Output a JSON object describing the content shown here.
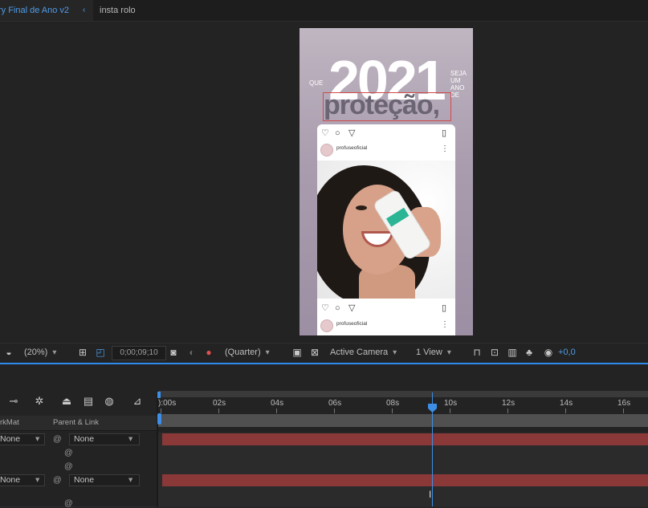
{
  "tabs": [
    {
      "label": "ry Final de Ano v2",
      "active": true
    },
    {
      "label": "insta rolo",
      "active": false
    }
  ],
  "composition": {
    "year": "2021",
    "que": "QUE",
    "seja": [
      "SEJA",
      "UM",
      "ANO",
      "DE"
    ],
    "protecao": "proteção,",
    "instagram_user_top": "profuseoficial",
    "instagram_user_bottom": "profuseoficial",
    "more_glyph": "⋮"
  },
  "viewer_toolbar": {
    "zoom": "(20%)",
    "timecode": "0;00;09;10",
    "resolution": "(Quarter)",
    "camera": "Active Camera",
    "views": "1 View",
    "exposure": "+0,0"
  },
  "timeline": {
    "ruler_labels": [
      "):00s",
      "02s",
      "04s",
      "06s",
      "08s",
      "10s",
      "12s",
      "14s",
      "16s"
    ],
    "columns": {
      "trkmat": "rkMat",
      "parent": "Parent & Link"
    },
    "layers": [
      {
        "trkmat": "None",
        "parent": "None",
        "has_bar": true
      },
      {
        "trkmat": "",
        "parent": "",
        "has_bar": false
      },
      {
        "trkmat": "",
        "parent": "",
        "has_bar": false
      },
      {
        "trkmat": "None",
        "parent": "None",
        "has_bar": true
      },
      {
        "trkmat": "",
        "parent": "",
        "has_bar": false
      }
    ]
  },
  "icons": {
    "chevron_tab": "‹",
    "spiral": "@"
  },
  "colors": {
    "accent_blue": "#4f9ce8",
    "track_red": "#8b3838"
  }
}
